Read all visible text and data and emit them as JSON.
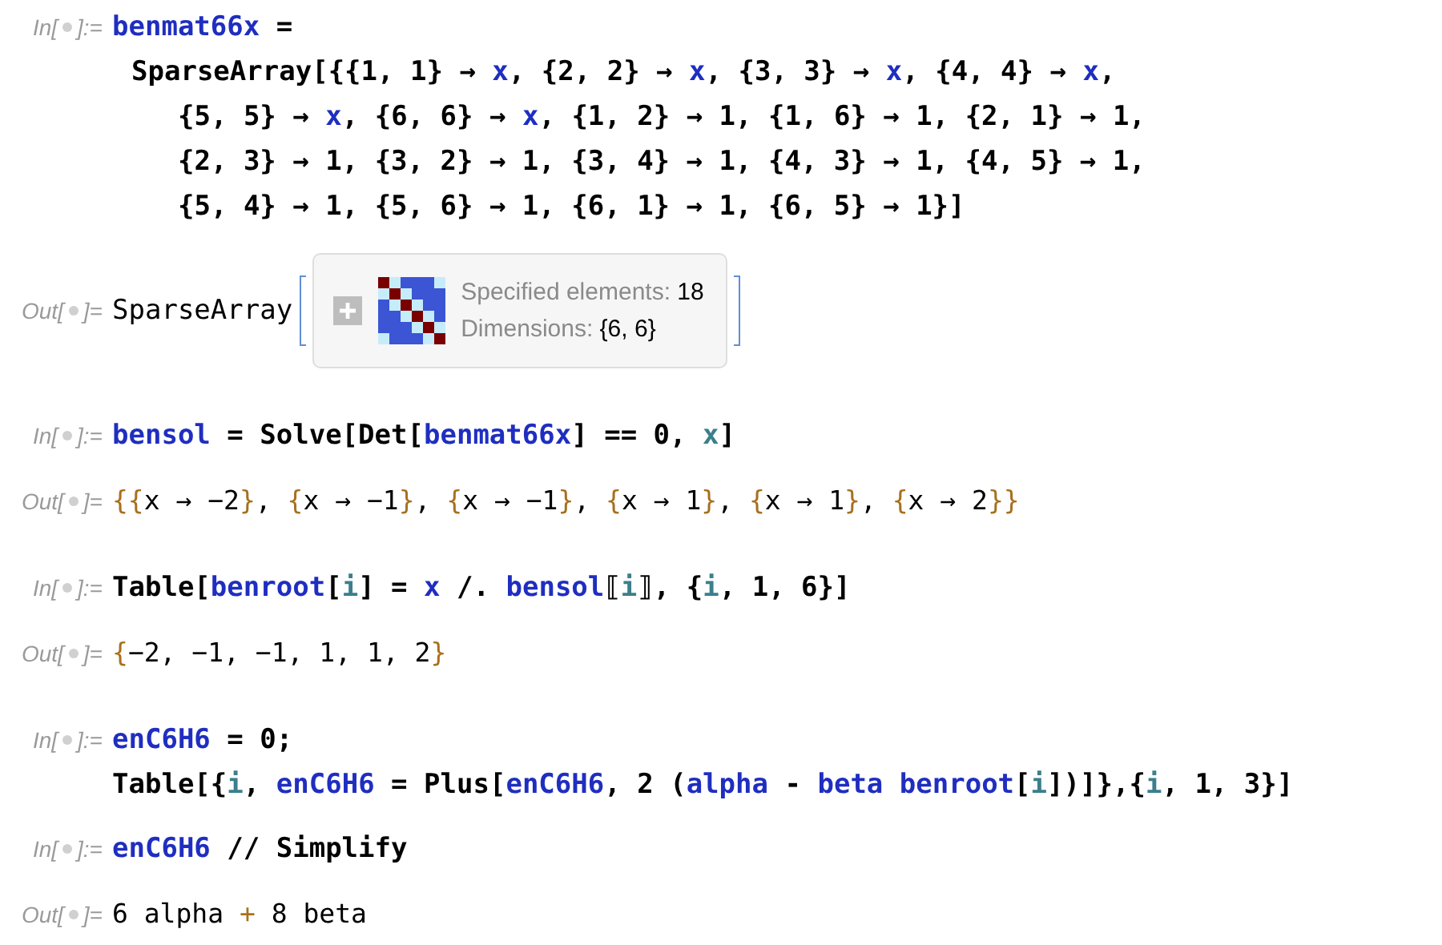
{
  "cells": [
    {
      "kind": "input",
      "label_start": "In[",
      "label_end": "]:=",
      "lines": [
        {
          "kind": "start",
          "tokens": [
            {
              "text": "benmat66x",
              "kind": "variable"
            },
            {
              "text": " =",
              "kind": "symbol"
            }
          ]
        },
        {
          "kind": "continued",
          "tokens": [
            {
              "text": "SparseArray[{{1, 1} → ",
              "kind": "symbol"
            },
            {
              "text": "x",
              "kind": "variable"
            },
            {
              "text": ", {2, 2} → ",
              "kind": "symbol"
            },
            {
              "text": "x",
              "kind": "variable"
            },
            {
              "text": ", {3, 3} → ",
              "kind": "symbol"
            },
            {
              "text": "x",
              "kind": "variable"
            },
            {
              "text": ", {4, 4} → ",
              "kind": "symbol"
            },
            {
              "text": "x",
              "kind": "variable"
            },
            {
              "text": ",",
              "kind": "symbol"
            }
          ]
        },
        {
          "kind": "wrapped",
          "tokens": [
            {
              "text": "{5, 5} → ",
              "kind": "symbol"
            },
            {
              "text": "x",
              "kind": "variable"
            },
            {
              "text": ", {6, 6} → ",
              "kind": "symbol"
            },
            {
              "text": "x",
              "kind": "variable"
            },
            {
              "text": ", {1, 2} → 1, {1, 6} → 1, {2, 1} → 1,",
              "kind": "symbol"
            }
          ]
        },
        {
          "kind": "wrapped",
          "tokens": [
            {
              "text": "{2, 3} → 1, {3, 2} → 1, {3, 4} → 1, {4, 3} → 1, {4, 5} → 1,",
              "kind": "symbol"
            }
          ]
        },
        {
          "kind": "wrapped",
          "tokens": [
            {
              "text": "{5, 4} → 1, {5, 6} → 1, {6, 1} → 1, {6, 5} → 1}]",
              "kind": "symbol"
            }
          ]
        }
      ]
    },
    {
      "kind": "summary",
      "label_start": "Out[",
      "label_end": "]=",
      "head": "SparseArray",
      "fields": [
        {
          "label": "Specified elements:",
          "value": "18"
        },
        {
          "label": "Dimensions:",
          "value": "{6, 6}"
        }
      ]
    },
    {
      "kind": "input",
      "label_start": "In[",
      "label_end": "]:=",
      "lines": [
        {
          "kind": "start",
          "tokens": [
            {
              "text": "bensol",
              "kind": "variable"
            },
            {
              "text": " = Solve[Det[",
              "kind": "symbol"
            },
            {
              "text": "benmat66x",
              "kind": "variable"
            },
            {
              "text": "] == 0, ",
              "kind": "symbol"
            },
            {
              "text": "x",
              "kind": "local"
            },
            {
              "text": "]",
              "kind": "symbol"
            }
          ]
        }
      ]
    },
    {
      "kind": "output",
      "label_start": "Out[",
      "label_end": "]=",
      "lines": [
        {
          "kind": "start",
          "tokens": [
            {
              "text": "{{",
              "kind": "bracket"
            },
            {
              "text": "x → −2",
              "kind": "plain"
            },
            {
              "text": "}",
              "kind": "bracket"
            },
            {
              "text": ", ",
              "kind": "plain"
            },
            {
              "text": "{",
              "kind": "bracket"
            },
            {
              "text": "x → −1",
              "kind": "plain"
            },
            {
              "text": "}",
              "kind": "bracket"
            },
            {
              "text": ", ",
              "kind": "plain"
            },
            {
              "text": "{",
              "kind": "bracket"
            },
            {
              "text": "x → −1",
              "kind": "plain"
            },
            {
              "text": "}",
              "kind": "bracket"
            },
            {
              "text": ", ",
              "kind": "plain"
            },
            {
              "text": "{",
              "kind": "bracket"
            },
            {
              "text": "x → 1",
              "kind": "plain"
            },
            {
              "text": "}",
              "kind": "bracket"
            },
            {
              "text": ", ",
              "kind": "plain"
            },
            {
              "text": "{",
              "kind": "bracket"
            },
            {
              "text": "x → 1",
              "kind": "plain"
            },
            {
              "text": "}",
              "kind": "bracket"
            },
            {
              "text": ", ",
              "kind": "plain"
            },
            {
              "text": "{",
              "kind": "bracket"
            },
            {
              "text": "x → 2",
              "kind": "plain"
            },
            {
              "text": "}}",
              "kind": "bracket"
            }
          ]
        }
      ]
    },
    {
      "kind": "input",
      "label_start": "In[",
      "label_end": "]:=",
      "lines": [
        {
          "kind": "start",
          "tokens": [
            {
              "text": "Table[",
              "kind": "symbol"
            },
            {
              "text": "benroot",
              "kind": "variable"
            },
            {
              "text": "[",
              "kind": "symbol"
            },
            {
              "text": "i",
              "kind": "local"
            },
            {
              "text": "] = ",
              "kind": "symbol"
            },
            {
              "text": "x",
              "kind": "variable"
            },
            {
              "text": " /. ",
              "kind": "symbol"
            },
            {
              "text": "bensol",
              "kind": "variable"
            },
            {
              "text": "⟦",
              "kind": "symbol"
            },
            {
              "text": "i",
              "kind": "local"
            },
            {
              "text": "⟧, {",
              "kind": "symbol"
            },
            {
              "text": "i",
              "kind": "local"
            },
            {
              "text": ", 1, 6}]",
              "kind": "symbol"
            }
          ]
        }
      ]
    },
    {
      "kind": "output",
      "label_start": "Out[",
      "label_end": "]=",
      "lines": [
        {
          "kind": "start",
          "tokens": [
            {
              "text": "{",
              "kind": "bracket"
            },
            {
              "text": "−2, −1, −1, 1, 1, 2",
              "kind": "plain"
            },
            {
              "text": "}",
              "kind": "bracket"
            }
          ]
        }
      ]
    },
    {
      "kind": "input",
      "label_start": "In[",
      "label_end": "]:=",
      "lines": [
        {
          "kind": "start",
          "tokens": [
            {
              "text": "enC6H6",
              "kind": "variable"
            },
            {
              "text": " = 0;",
              "kind": "symbol"
            }
          ]
        },
        {
          "kind": "start",
          "tokens": [
            {
              "text": "Table[{",
              "kind": "symbol"
            },
            {
              "text": "i",
              "kind": "local"
            },
            {
              "text": ", ",
              "kind": "symbol"
            },
            {
              "text": "enC6H6",
              "kind": "variable"
            },
            {
              "text": " = Plus[",
              "kind": "symbol"
            },
            {
              "text": "enC6H6",
              "kind": "variable"
            },
            {
              "text": ", 2 (",
              "kind": "symbol"
            },
            {
              "text": "alpha",
              "kind": "variable"
            },
            {
              "text": " - ",
              "kind": "symbol"
            },
            {
              "text": "beta benroot",
              "kind": "variable"
            },
            {
              "text": "[",
              "kind": "symbol"
            },
            {
              "text": "i",
              "kind": "local"
            },
            {
              "text": "])]},{",
              "kind": "symbol"
            },
            {
              "text": "i",
              "kind": "local"
            },
            {
              "text": ", 1, 3}]",
              "kind": "symbol"
            }
          ]
        }
      ]
    },
    {
      "kind": "input",
      "label_start": "In[",
      "label_end": "]:=",
      "lines": [
        {
          "kind": "start",
          "tokens": [
            {
              "text": "enC6H6",
              "kind": "variable"
            },
            {
              "text": " // Simplify",
              "kind": "symbol"
            }
          ]
        }
      ]
    },
    {
      "kind": "output",
      "label_start": "Out[",
      "label_end": "]=",
      "lines": [
        {
          "kind": "start",
          "tokens": [
            {
              "text": "6 alpha ",
              "kind": "plain"
            },
            {
              "text": "+",
              "kind": "bracket"
            },
            {
              "text": " 8 beta",
              "kind": "plain"
            }
          ]
        }
      ]
    }
  ]
}
